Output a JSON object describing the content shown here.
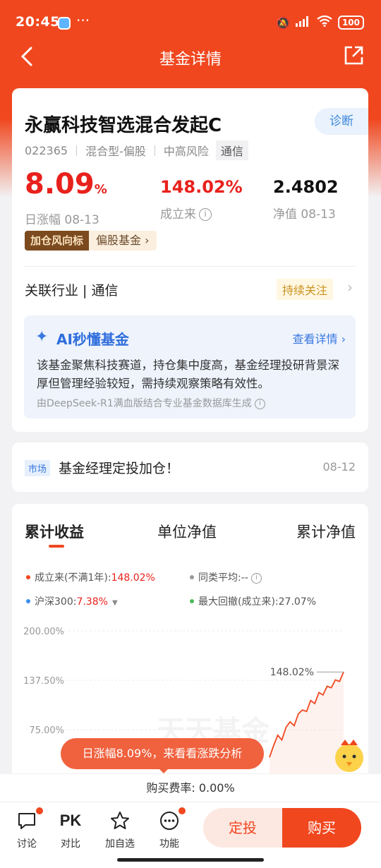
{
  "status": {
    "time": "20:45",
    "dots": "···",
    "battery": "100"
  },
  "nav": {
    "title": "基金详情"
  },
  "fund": {
    "name": "永赢科技智选混合发起C",
    "diagnose_label": "诊断",
    "code": "022365",
    "type": "混合型-偏股",
    "risk": "中高风险",
    "sector_tag": "通信",
    "daily_change_value": "8.09",
    "daily_change_unit": "%",
    "daily_change_label": "日涨幅 08-13",
    "since_inception": "148.02%",
    "since_inception_label": "成立来",
    "nav_value": "2.4802",
    "nav_label": "净值 08-13",
    "badge_dark": "加仓风向标",
    "badge_light": "偏股基金",
    "industry_label": "关联行业 | 通信",
    "follow_label": "持续关注"
  },
  "ai": {
    "title": "AI秒懂基金",
    "more": "查看详情",
    "text": "该基金聚焦科技赛道，持仓集中度高，基金经理投研背景深厚但管理经验较短，需持续观察策略有效性。",
    "footer": "由DeepSeek-R1满血版结合专业基金数据库生成"
  },
  "news": {
    "tag": "市场",
    "title": "基金经理定投加仓！",
    "date": "08-12"
  },
  "chart_tabs": [
    "累计收益",
    "单位净值",
    "累计净值"
  ],
  "legend": {
    "fund_label": "成立来(不满1年):",
    "fund_value": "148.02%",
    "peer_label": "同类平均:--",
    "index_label": "沪深300:",
    "index_value": "7.38%",
    "drawdown_label": "最大回撤(成立来):27.07%"
  },
  "chart_data": {
    "type": "line",
    "yticks": [
      "200.00%",
      "137.50%",
      "75.00%"
    ],
    "ylim": [
      75,
      200
    ],
    "end_label": "148.02%",
    "watermark": "天天基金",
    "series": [
      {
        "name": "成立来",
        "color": "#f0471f",
        "y": [
          40,
          55,
          68,
          62,
          78,
          85,
          80,
          95,
          100,
          98,
          112,
          108,
          122,
          119,
          130,
          128,
          138,
          136,
          148.02
        ]
      }
    ]
  },
  "popup": "日涨幅8.09%，来看看涨跌分析",
  "fee": "购买费率: 0.00%",
  "bottom": {
    "discuss": "讨论",
    "pk_icon": "PK",
    "compare": "对比",
    "watchlist": "加自选",
    "functions": "功能",
    "dingtou": "定投",
    "buy": "购买"
  },
  "colors": {
    "brand": "#f0471f",
    "up": "#e8211c",
    "accent_blue": "#3a78e0"
  }
}
